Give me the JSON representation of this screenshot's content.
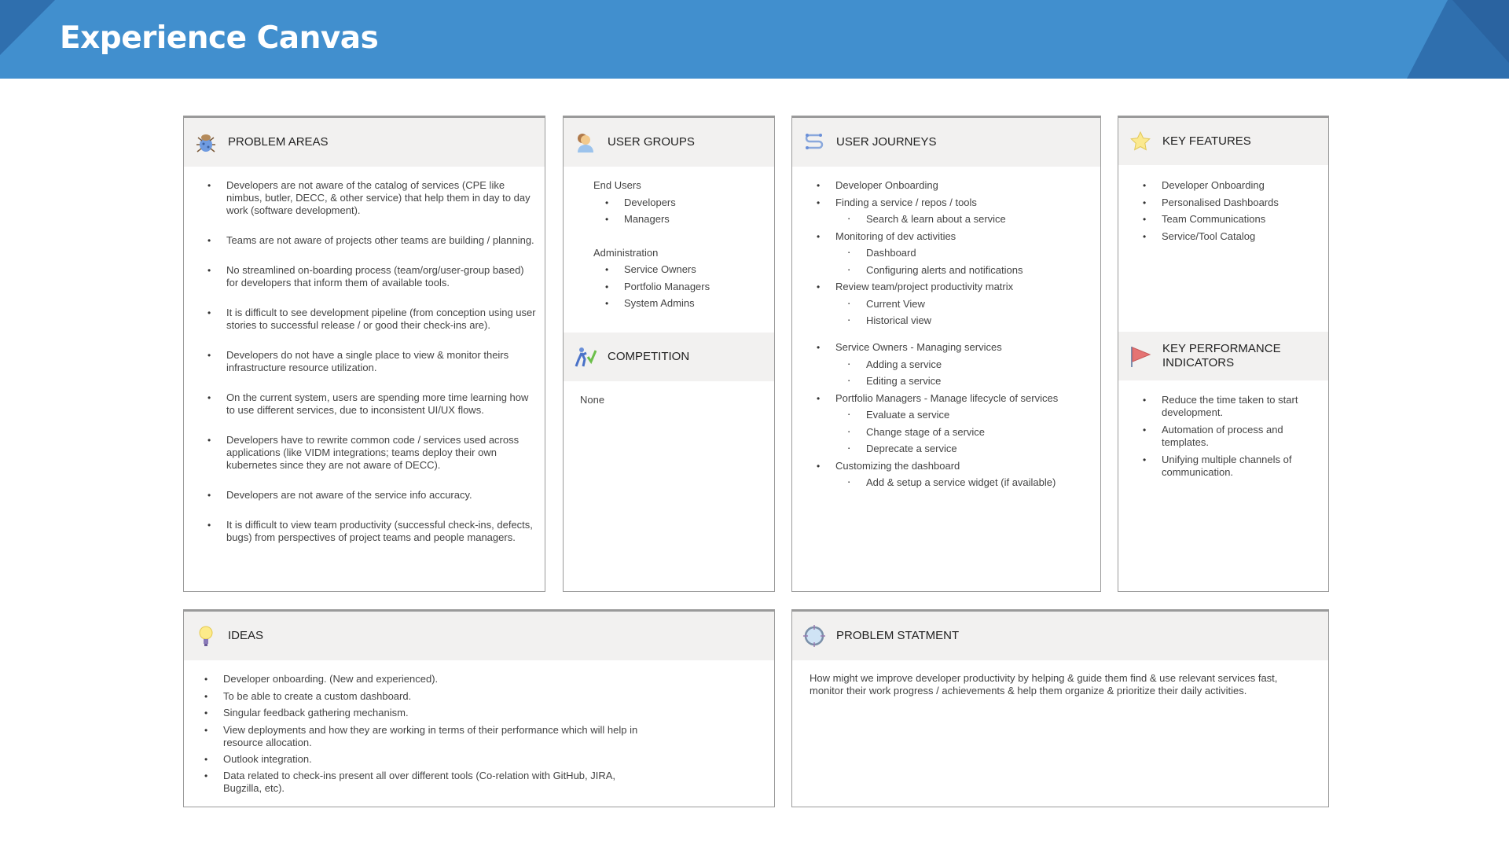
{
  "header": {
    "title": "Experience Canvas"
  },
  "problem_areas": {
    "title": "PROBLEM AREAS",
    "icon": "bug-icon",
    "items": [
      "Developers are not aware of the catalog of services (CPE like nimbus, butler, DECC, & other service) that help them in day to day work (software development).",
      "Teams are not aware of projects other teams are building / planning.",
      "No streamlined on-boarding process (team/org/user-group based) for developers that inform them of available tools.",
      "It is difficult to see development pipeline (from conception using user stories to successful release / or good their check-ins are).",
      "Developers do not have a single place to view & monitor theirs infrastructure resource utilization.",
      "On the current system, users are spending more time learning how to use different services, due to inconsistent UI/UX flows.",
      "Developers have to rewrite common code / services used across applications (like VIDM integrations; teams deploy their own kubernetes since they are not aware of DECC).",
      "Developers are not aware of the service info accuracy.",
      "It is difficult to view team productivity (successful check-ins, defects, bugs) from perspectives of project teams and people managers."
    ]
  },
  "user_groups": {
    "title": "USER GROUPS",
    "icon": "users-icon",
    "groups": [
      {
        "heading": "End Users",
        "items": [
          "Developers",
          "Managers"
        ]
      },
      {
        "heading": "Administration",
        "items": [
          "Service Owners",
          "Portfolio Managers",
          "System Admins"
        ]
      }
    ]
  },
  "competition": {
    "title": "COMPETITION",
    "icon": "runner-icon",
    "text": "None"
  },
  "user_journeys": {
    "title": "USER JOURNEYS",
    "icon": "path-icon",
    "groups": [
      [
        {
          "t": "Developer Onboarding",
          "l": 1
        },
        {
          "t": "Finding a service / repos / tools",
          "l": 1
        },
        {
          "t": "Search & learn about a service",
          "l": 2
        },
        {
          "t": "Monitoring of dev activities",
          "l": 1
        },
        {
          "t": "Dashboard",
          "l": 2
        },
        {
          "t": "Configuring alerts and notifications",
          "l": 2
        },
        {
          "t": "Review team/project productivity matrix",
          "l": 1
        },
        {
          "t": "Current View",
          "l": 2
        },
        {
          "t": "Historical view",
          "l": 2
        }
      ],
      [
        {
          "t": "Service Owners - Managing services",
          "l": 1
        },
        {
          "t": "Adding a service",
          "l": 2
        },
        {
          "t": "Editing a service",
          "l": 2
        },
        {
          "t": "Portfolio Managers - Manage lifecycle of services",
          "l": 1
        },
        {
          "t": "Evaluate a service",
          "l": 2
        },
        {
          "t": "Change stage of a service",
          "l": 2
        },
        {
          "t": "Deprecate a service",
          "l": 2
        },
        {
          "t": "Customizing the dashboard",
          "l": 1
        },
        {
          "t": "Add & setup a service widget (if available)",
          "l": 2
        }
      ]
    ]
  },
  "key_features": {
    "title": "KEY FEATURES",
    "icon": "star-icon",
    "items": [
      "Developer Onboarding",
      "Personalised Dashboards",
      "Team Communications",
      "Service/Tool Catalog"
    ]
  },
  "kpis": {
    "title": "KEY PERFORMANCE INDICATORS",
    "icon": "flag-icon",
    "items": [
      "Reduce the time taken to start development.",
      "Automation of process and templates.",
      "Unifying multiple channels of communication."
    ]
  },
  "ideas": {
    "title": "IDEAS",
    "icon": "lightbulb-icon",
    "items": [
      "Developer onboarding. (New and experienced).",
      "To be able to create a custom dashboard.",
      "Singular feedback gathering mechanism.",
      "View deployments and how they are working in terms of their performance which will help in resource allocation.",
      "Outlook integration.",
      "Data related to check-ins present all over different tools (Co-relation with GitHub, JIRA, Bugzilla, etc)."
    ]
  },
  "problem_statement": {
    "title": "PROBLEM STATMENT",
    "icon": "target-icon",
    "text": "How might we improve developer productivity by helping & guide them find & use relevant services fast, monitor their work progress / achievements & help them organize & prioritize their daily activities."
  }
}
